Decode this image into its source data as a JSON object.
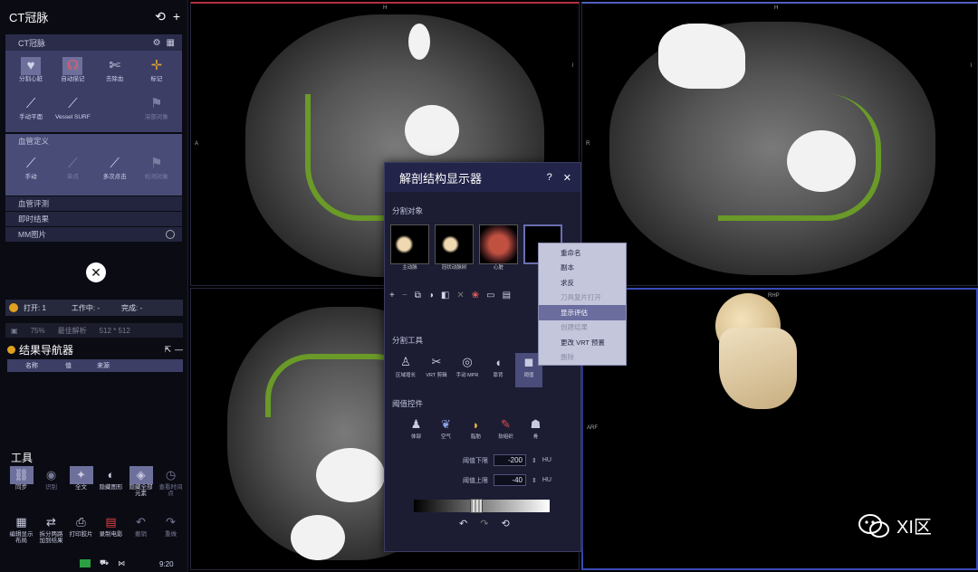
{
  "app": {
    "title": "CT冠脉"
  },
  "panel": {
    "section_title": "CT冠脉",
    "tools_row1": [
      {
        "label": "分割心脏",
        "icon": "heart-segment-icon"
      },
      {
        "label": "自动描记",
        "icon": "auto-trace-icon"
      },
      {
        "label": "去除血",
        "icon": "remove-blood-icon"
      },
      {
        "label": "",
        "icon": "blank"
      },
      {
        "label": "标记",
        "icon": "mark-icon"
      }
    ],
    "tools_row2": [
      {
        "label": "手动平面",
        "icon": "manual-plane-icon"
      },
      {
        "label": "Vessel SURF",
        "icon": "vessel-surf-icon"
      },
      {
        "label": "",
        "icon": "blank"
      },
      {
        "label": "深部对象",
        "icon": "deep-object-icon"
      }
    ],
    "vessel_define": "血管定义",
    "vessel_tools": [
      {
        "label": "手动",
        "icon": "manual-icon"
      },
      {
        "label": "单点",
        "icon": "single-point-icon"
      },
      {
        "label": "多次点击",
        "icon": "multi-click-icon"
      },
      {
        "label": "",
        "icon": "blank"
      },
      {
        "label": "检测对象",
        "icon": "detect-icon"
      }
    ],
    "vessel_eval": "血管评测",
    "instant_result": "即时结果",
    "mm_image": "MM图片"
  },
  "status": {
    "open": "打开: 1",
    "work": "工作中: -",
    "done": "完成: -"
  },
  "quality": {
    "percent": "75%",
    "label": "最佳解析",
    "resolution": "512 * 512"
  },
  "navigator": {
    "title": "结果导航器",
    "columns": [
      "名称",
      "值",
      "来源"
    ]
  },
  "tools": {
    "title": "工具",
    "row1": [
      {
        "label": "同步",
        "icon": "sync-icon"
      },
      {
        "label": "识别",
        "icon": "recognize-icon"
      },
      {
        "label": "全文",
        "icon": "fulltext-icon"
      },
      {
        "label": "隐藏图形",
        "icon": "hide-graphic-icon"
      },
      {
        "label": "隐藏全部元素",
        "icon": "hide-all-icon"
      },
      {
        "label": "查看时间点",
        "icon": "time-point-icon"
      }
    ],
    "row2": [
      {
        "label": "编辑显示布局",
        "icon": "layout-icon"
      },
      {
        "label": "拆分两路加到结果",
        "icon": "split-icon"
      },
      {
        "label": "打印胶片",
        "icon": "print-icon"
      },
      {
        "label": "录制电影",
        "icon": "record-icon"
      },
      {
        "label": "撤销",
        "icon": "undo-icon"
      },
      {
        "label": "重做",
        "icon": "redo-icon"
      }
    ]
  },
  "time": "9:20",
  "viewports": [
    {
      "orient_top": "H",
      "orient_left": "A",
      "orient_right": "I"
    },
    {
      "orient_top": "H",
      "orient_left": "R",
      "orient_right": "I"
    },
    {
      "orient_top": "",
      "orient_left": "",
      "orient_right": ""
    },
    {
      "orient_top": "RHP",
      "orient_left": "ARF",
      "orient_right": ""
    }
  ],
  "dialog": {
    "title": "解剖结构显示器",
    "seg_objects": "分割对象",
    "thumbs": [
      {
        "caption": "主动脉"
      },
      {
        "caption": "冠状动脉树"
      },
      {
        "caption": "心脏"
      },
      {
        "caption": ""
      }
    ],
    "seg_tools_title": "分割工具",
    "seg_tools": [
      {
        "label": "区域增长",
        "icon": "region-grow-icon"
      },
      {
        "label": "VRT 剪辑",
        "icon": "vrt-clip-icon"
      },
      {
        "label": "手动 MPR",
        "icon": "manual-mpr-icon"
      },
      {
        "label": "靠背",
        "icon": "back-icon"
      },
      {
        "label": "阈值",
        "icon": "threshold-icon"
      }
    ],
    "thr_title": "阈值控件",
    "thr_tools": [
      {
        "label": "体部",
        "icon": "body-icon"
      },
      {
        "label": "空气",
        "icon": "air-icon"
      },
      {
        "label": "脂肪",
        "icon": "fat-icon"
      },
      {
        "label": "软组织",
        "icon": "soft-tissue-icon"
      },
      {
        "label": "骨",
        "icon": "bone-icon"
      }
    ],
    "thr_lower_label": "阈值下限",
    "thr_lower": "-200",
    "thr_upper_label": "阈值上限",
    "thr_upper": "-40",
    "unit": "HU"
  },
  "context_menu": {
    "items": [
      {
        "label": "重命名",
        "state": "normal"
      },
      {
        "label": "副本",
        "state": "normal"
      },
      {
        "label": "求反",
        "state": "normal"
      },
      {
        "label": "刀具复片打开",
        "state": "dim"
      },
      {
        "label": "显示评估",
        "state": "highlight"
      },
      {
        "label": "创建结果",
        "state": "dim"
      },
      {
        "label": "更改 VRT 预置",
        "state": "normal"
      },
      {
        "label": "删除",
        "state": "dim"
      }
    ]
  },
  "watermark": "XI区"
}
